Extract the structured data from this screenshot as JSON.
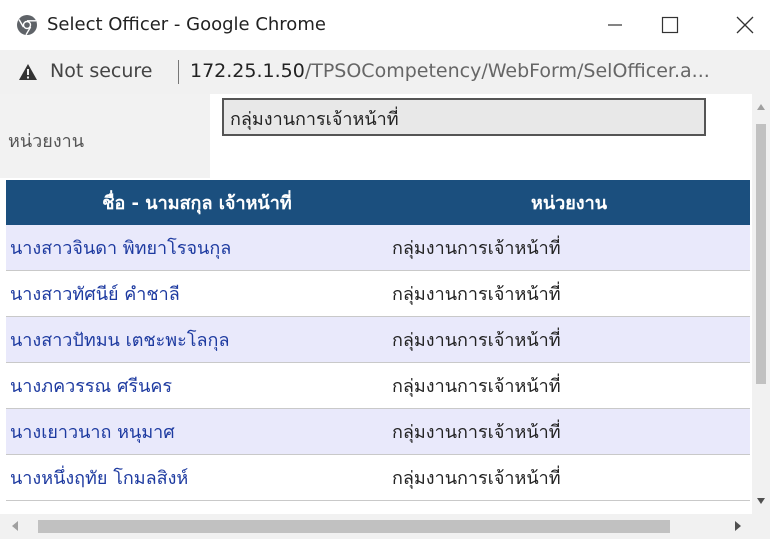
{
  "window": {
    "title": "Select Officer - Google Chrome",
    "icons": {
      "app": "chrome-icon",
      "minimize": "minimize-icon",
      "maximize": "maximize-icon",
      "close": "close-icon"
    }
  },
  "address_bar": {
    "security": "Not secure",
    "url_host": "172.25.1.50",
    "url_path": "/TPSOCompetency/WebForm/SelOfficer.a..."
  },
  "filter": {
    "label": "หน่วยงาน",
    "value": "กลุ่มงานการเจ้าหน้าที่"
  },
  "table": {
    "headers": {
      "name": "ชื่อ - นามสกุล เจ้าหน้าที่",
      "unit": "หน่วยงาน"
    },
    "rows": [
      {
        "name": "นางสาวจินดา พิทยาโรจนกุล",
        "unit": "กลุ่มงานการเจ้าหน้าที่"
      },
      {
        "name": "นางสาวทัศนีย์ คำชาลี",
        "unit": "กลุ่มงานการเจ้าหน้าที่"
      },
      {
        "name": "นางสาวปัทมน เตชะพะโลกุล",
        "unit": "กลุ่มงานการเจ้าหน้าที่"
      },
      {
        "name": "นางภควรรณ ศรีนคร",
        "unit": "กลุ่มงานการเจ้าหน้าที่"
      },
      {
        "name": "นางเยาวนาถ หนุมาศ",
        "unit": "กลุ่มงานการเจ้าหน้าที่"
      },
      {
        "name": "นางหนึ่งฤทัย โกมลสิงห์",
        "unit": "กลุ่มงานการเจ้าหน้าที่"
      }
    ]
  },
  "colors": {
    "header_bg": "#1b4f7e",
    "odd_row_bg": "#e9e9fb",
    "link": "#1d3aa0"
  }
}
